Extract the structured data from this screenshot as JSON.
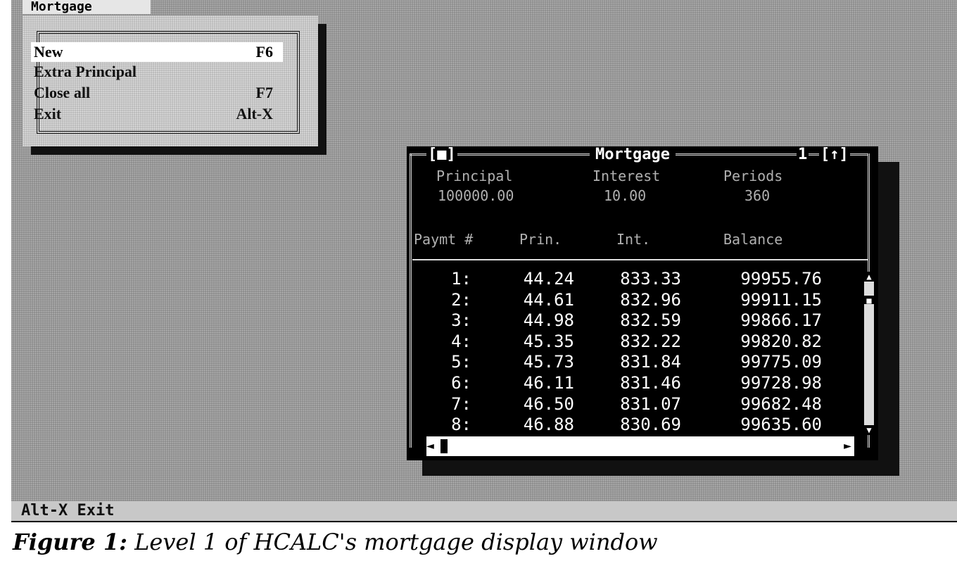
{
  "menubar": {
    "title": "Mortgage"
  },
  "menu": {
    "items": [
      {
        "label": "New",
        "shortcut": "F6"
      },
      {
        "label": "Extra Principal",
        "shortcut": ""
      },
      {
        "label": "Close all",
        "shortcut": "F7"
      },
      {
        "label": "Exit",
        "shortcut": "Alt-X"
      }
    ]
  },
  "window": {
    "close_box": "[■]",
    "title": "Mortgage",
    "number": "1",
    "zoom_box": "[↑]",
    "inputs": {
      "principal_label": "Principal",
      "interest_label": "Interest",
      "periods_label": "Periods",
      "principal_value": "100000.00",
      "interest_value": "10.00",
      "periods_value": "360"
    },
    "columns": {
      "payment": "Paymt #",
      "principal": "Prin.",
      "interest": "Int.",
      "balance": "Balance"
    },
    "rows": [
      {
        "n": "1:",
        "prin": "44.24",
        "int": "833.33",
        "bal": "99955.76"
      },
      {
        "n": "2:",
        "prin": "44.61",
        "int": "832.96",
        "bal": "99911.15"
      },
      {
        "n": "3:",
        "prin": "44.98",
        "int": "832.59",
        "bal": "99866.17"
      },
      {
        "n": "4:",
        "prin": "45.35",
        "int": "832.22",
        "bal": "99820.82"
      },
      {
        "n": "5:",
        "prin": "45.73",
        "int": "831.84",
        "bal": "99775.09"
      },
      {
        "n": "6:",
        "prin": "46.11",
        "int": "831.46",
        "bal": "99728.98"
      },
      {
        "n": "7:",
        "prin": "46.50",
        "int": "831.07",
        "bal": "99682.48"
      },
      {
        "n": "8:",
        "prin": "46.88",
        "int": "830.69",
        "bal": "99635.60"
      }
    ],
    "vscroll": {
      "up": "▲",
      "thumb": "■",
      "down": "▼"
    },
    "hscroll": {
      "left": "◄",
      "right": "►"
    }
  },
  "status_bar": {
    "text": "Alt-X Exit"
  },
  "caption": {
    "label": "Figure 1:",
    "text": "Level 1 of HCALC's mortgage display window"
  }
}
